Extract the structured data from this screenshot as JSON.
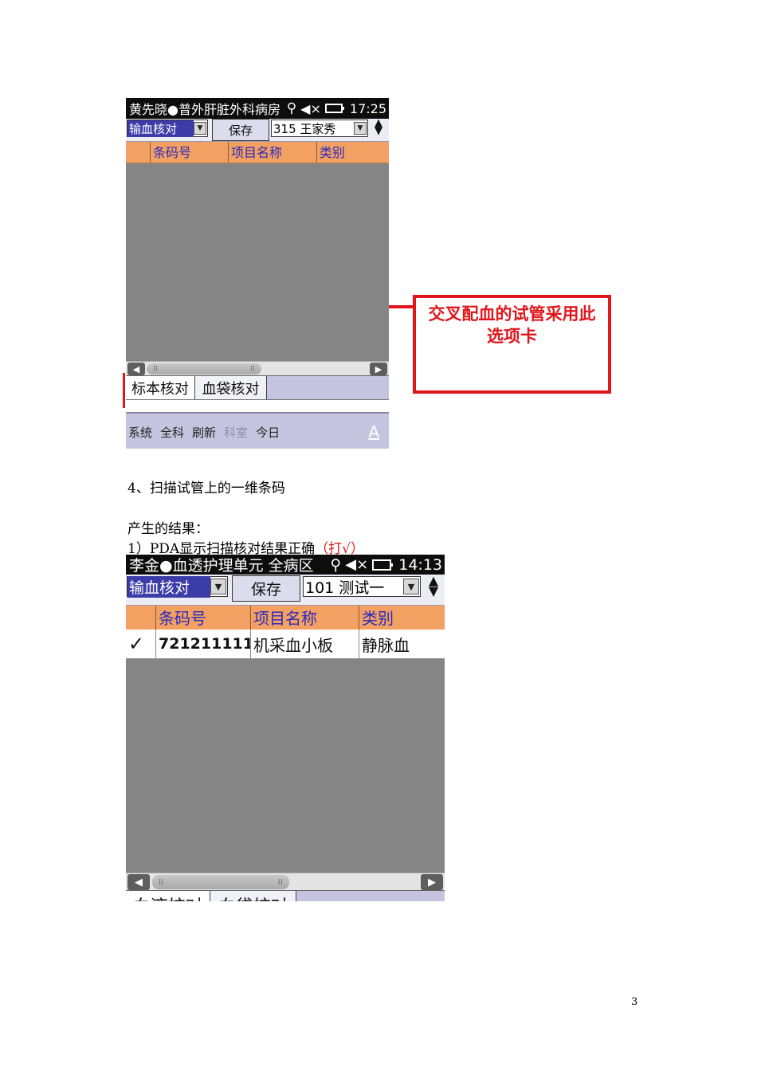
{
  "screen1": {
    "status_title": "黄先晓●普外肝脏外科病房",
    "time": "17:25",
    "mode_select": "输血核对",
    "save_button": "保存",
    "patient_select": "315 王家秀",
    "columns": [
      "",
      "条码号",
      "项目名称",
      "类别"
    ],
    "tabs": [
      "标本核对",
      "血袋核对"
    ],
    "menu": [
      "系统",
      "全科",
      "刷新",
      "科室",
      "今日"
    ],
    "menu_disabled": "科室",
    "input_indicator": "A"
  },
  "callout_text": "交叉配血的试管采用此选项卡",
  "step4": "4、扫描试管上的一维条码",
  "result_intro": "产生的结果：",
  "result_item_prefix": "1）PDA显示扫描核对结果正确",
  "result_item_note": "（打√）",
  "screen2": {
    "status_title": "李金●血透护理单元 全病区",
    "time": "14:13",
    "mode_select": "输血核对",
    "save_button": "保存",
    "patient_select": "101 测试一",
    "columns": [
      "",
      "条码号",
      "项目名称",
      "类别"
    ],
    "rows": [
      {
        "check": "✓",
        "barcode": "721211111",
        "item": "机采血小板",
        "type": "静脉血"
      }
    ],
    "tabs_partial": [
      "血液核对",
      "血袋核对"
    ]
  },
  "page_number": "3"
}
